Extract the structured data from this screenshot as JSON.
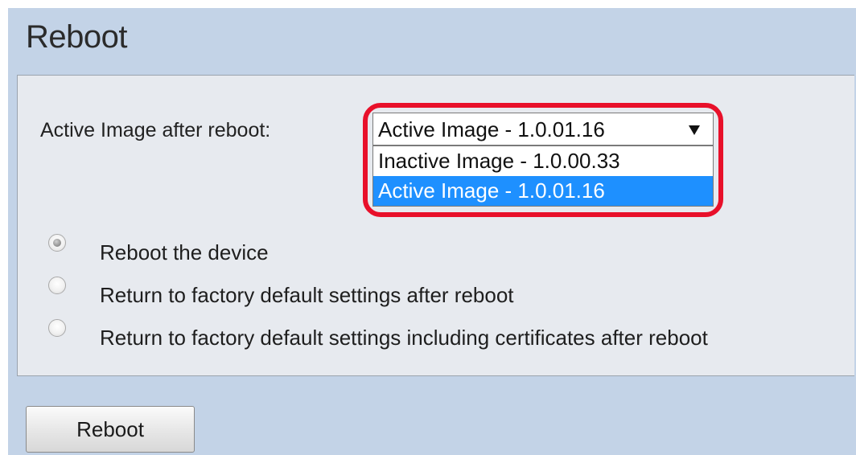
{
  "page": {
    "title": "Reboot"
  },
  "form": {
    "active_image_label": "Active Image after reboot:",
    "select": {
      "value": "Active Image - 1.0.01.16",
      "options": [
        {
          "label": "Inactive Image - 1.0.00.33",
          "selected": false
        },
        {
          "label": "Active Image - 1.0.01.16",
          "selected": true
        }
      ]
    },
    "radios": [
      {
        "label": "Reboot the device",
        "checked": true
      },
      {
        "label": "Return to factory default settings after reboot",
        "checked": false
      },
      {
        "label": "Return to factory default settings including certificates after reboot",
        "checked": false
      }
    ],
    "reboot_button": "Reboot"
  },
  "colors": {
    "background": "#c3d3e7",
    "panel": "#e7eaef",
    "highlight": "#e8102a",
    "selected_option": "#1e90ff"
  }
}
